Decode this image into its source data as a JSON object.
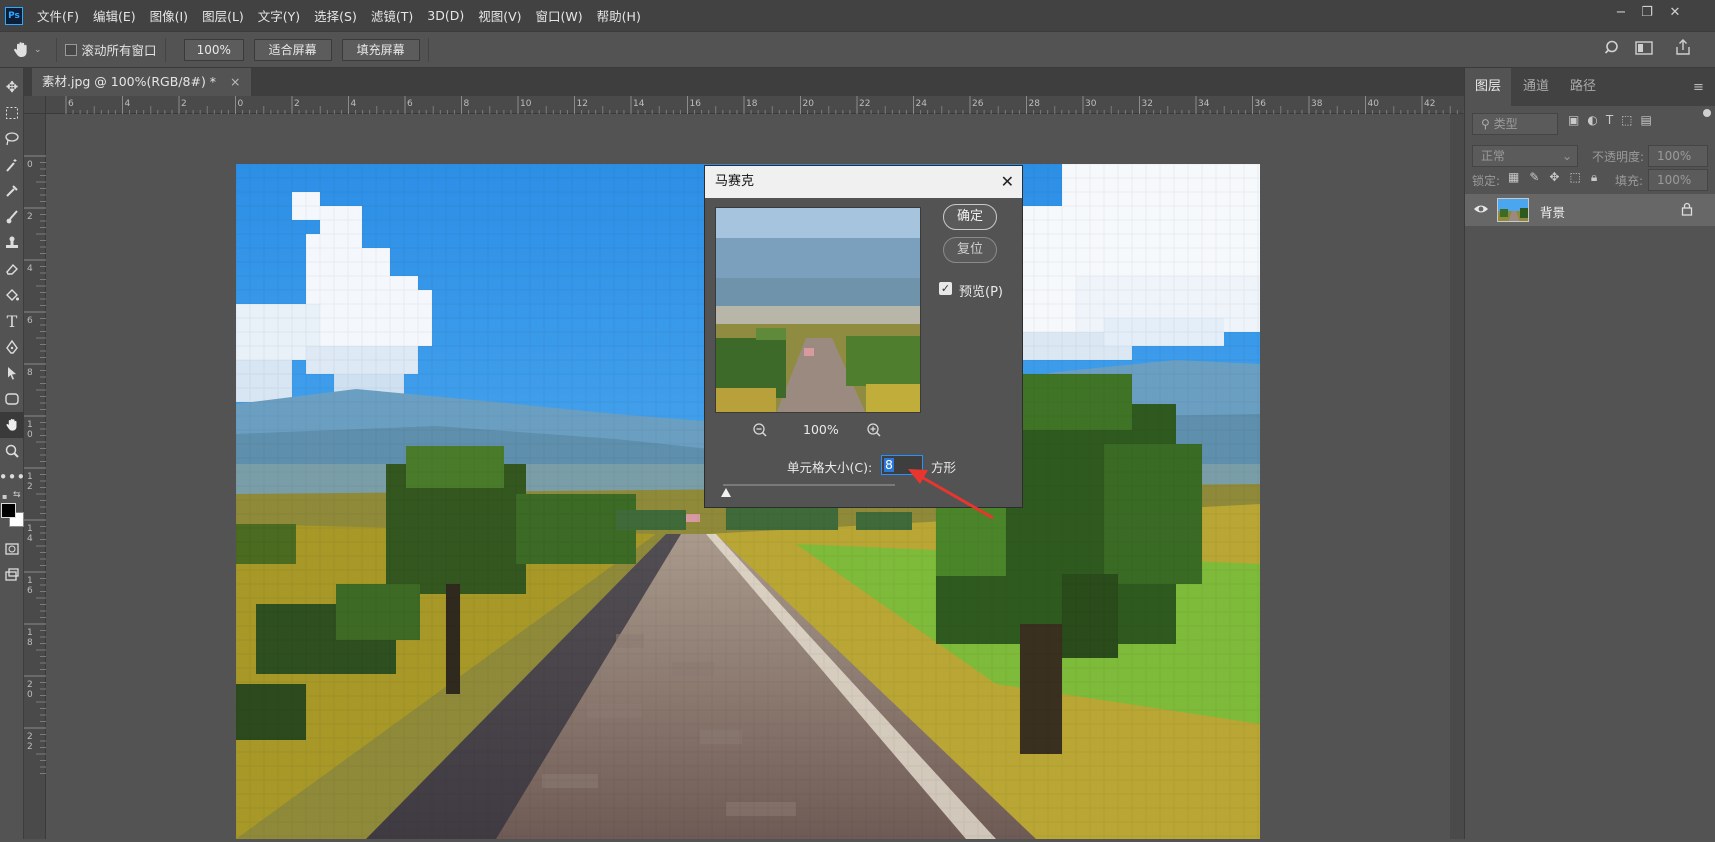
{
  "app": {
    "logo": "Ps"
  },
  "menu": [
    "文件(F)",
    "编辑(E)",
    "图像(I)",
    "图层(L)",
    "文字(Y)",
    "选择(S)",
    "滤镜(T)",
    "3D(D)",
    "视图(V)",
    "窗口(W)",
    "帮助(H)"
  ],
  "window_controls": {
    "minimize": "−",
    "restore": "❐",
    "close": "✕"
  },
  "options": {
    "tool_icon": "hand-icon",
    "scroll_all_label": "滚动所有窗口",
    "zoom_value": "100%",
    "fit_screen_label": "适合屏幕",
    "fill_screen_label": "填充屏幕"
  },
  "document": {
    "tab_title": "素材.jpg @ 100%(RGB/8#) *",
    "tab_close": "×"
  },
  "ruler": {
    "h_labels": [
      "6",
      "4",
      "2",
      "0",
      "2",
      "4",
      "6",
      "8",
      "10",
      "12",
      "14",
      "16",
      "18",
      "20",
      "22",
      "24",
      "26",
      "28",
      "30",
      "32",
      "34",
      "36",
      "38",
      "40",
      "42"
    ],
    "v_labels": [
      "0",
      "2",
      "4",
      "6",
      "8",
      "10",
      "12",
      "14",
      "16",
      "18",
      "20",
      "22"
    ]
  },
  "dialog": {
    "title": "马赛克",
    "close": "✕",
    "ok_label": "确定",
    "reset_label": "复位",
    "preview_label": "预览(P)",
    "preview_checked": true,
    "zoom_out": "−",
    "zoom_level": "100%",
    "zoom_in": "+",
    "cell_size_label": "单元格大小(C):",
    "cell_size_value": "8",
    "cell_unit": "方形"
  },
  "panel": {
    "tabs": [
      "图层",
      "通道",
      "路径"
    ],
    "active_tab": 0,
    "filter_placeholder": "类型",
    "blend_mode": "正常",
    "opacity_label": "不透明度:",
    "opacity_value": "100%",
    "lock_label": "锁定:",
    "fill_label": "填充:",
    "fill_value": "100%",
    "layers": [
      {
        "name": "背景",
        "visible": true,
        "locked": true
      }
    ]
  },
  "colors": {
    "accent": "#31a8ff",
    "annotation_arrow": "#e8362e",
    "ui_dark": "#424242",
    "ui_mid": "#535353"
  }
}
